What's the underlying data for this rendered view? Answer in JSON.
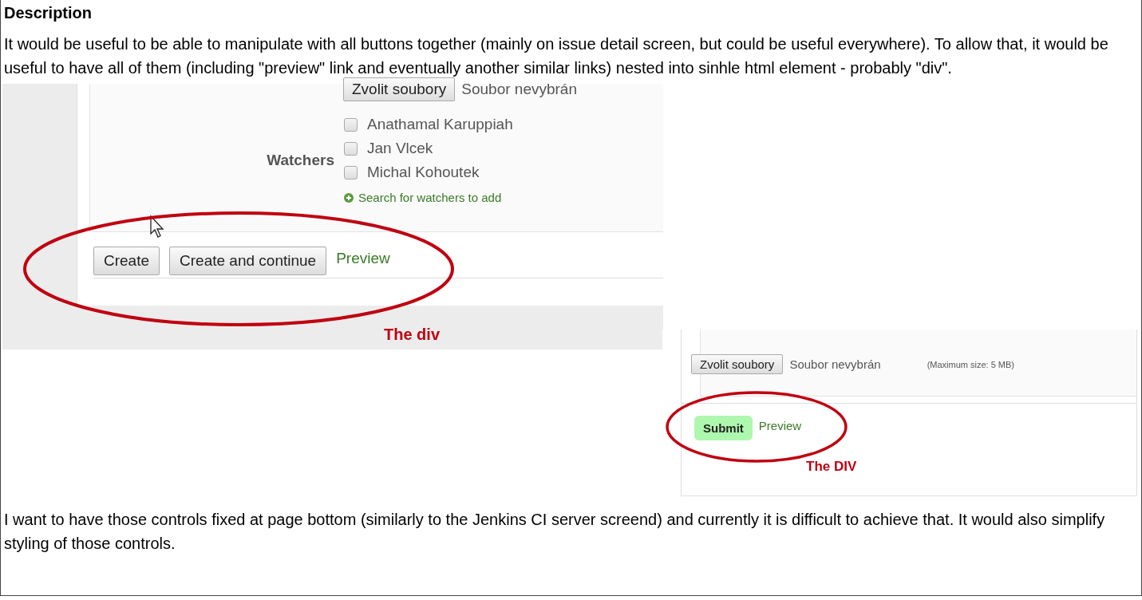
{
  "heading": "Description",
  "paragraphs": [
    "It would be useful to be able to manipulate with all buttons together (mainly on issue detail screen, but could be useful everywhere). To allow that, it would be useful to have all of them (including \"preview\" link and eventually another similar links) nested into sinhle html element - probably \"div\".",
    "I want to have those controls fixed at page bottom (similarly to the Jenkins CI server screend) and currently it is difficult to achieve that. It would also simplify styling of those controls."
  ],
  "screenshots": [
    {
      "kind": "create",
      "file_button": "Zvolit soubory",
      "file_status": "Soubor nevybrán",
      "watchers_label": "Watchers",
      "watchers": [
        {
          "name": "Anathamal Karuppiah",
          "checked": false
        },
        {
          "name": "Jan Vlcek",
          "checked": false
        },
        {
          "name": "Michal Kohoutek",
          "checked": false
        }
      ],
      "search_link": "Search for watchers to add",
      "buttons": [
        "Create",
        "Create and continue"
      ],
      "preview_link": "Preview",
      "annotation": "The div"
    },
    {
      "kind": "submit",
      "file_button": "Zvolit soubory",
      "file_status": "Soubor nevybrán",
      "max_size": "(Maximum size: 5 MB)",
      "submit_button": "Submit",
      "preview_link": "Preview",
      "annotation": "The DIV"
    }
  ]
}
